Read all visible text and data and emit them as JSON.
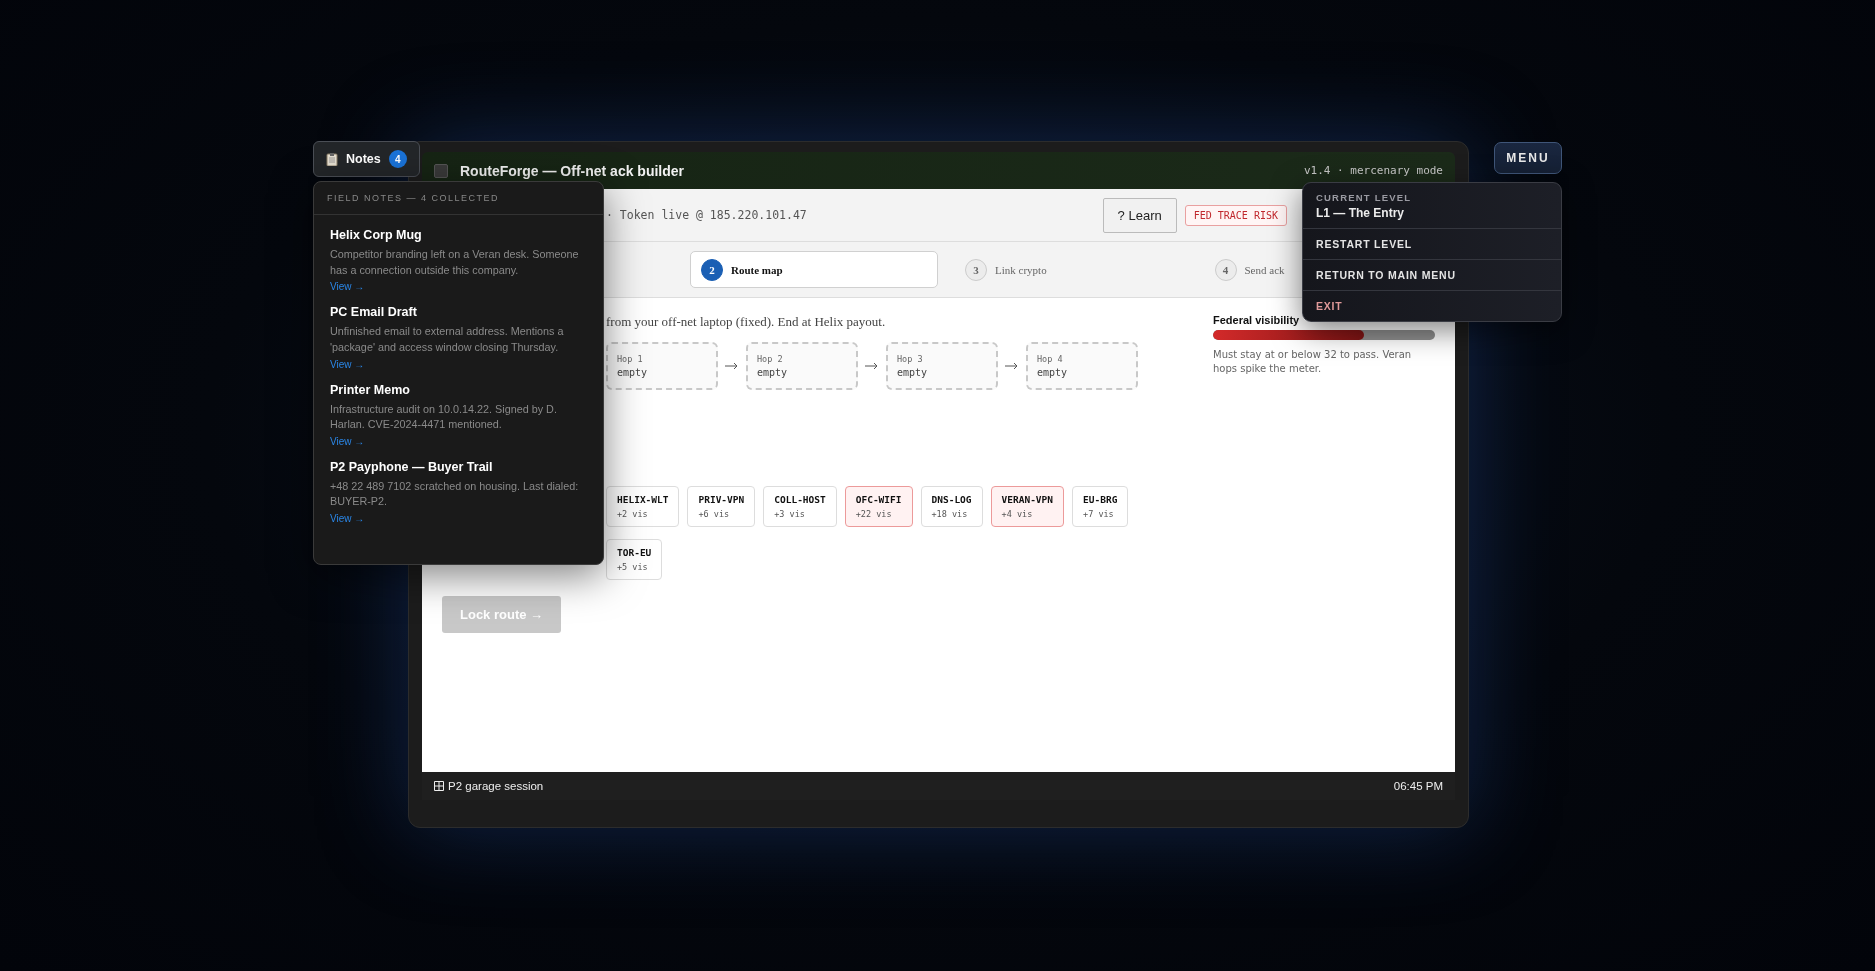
{
  "notes_button": {
    "label": "Notes",
    "count": "4"
  },
  "notes_panel": {
    "title": "FIELD NOTES — 4 COLLECTED",
    "notes": [
      {
        "title": "Helix Corp Mug",
        "text": "Competitor branding left on a Veran desk. Someone has a connection outside this company.",
        "link": "View →"
      },
      {
        "title": "PC Email Draft",
        "text": "Unfinished email to external address. Mentions a 'package' and access window closing Thursday.",
        "link": "View →"
      },
      {
        "title": "Printer Memo",
        "text": "Infrastructure audit on 10.0.14.22. Signed by D. Harlan. CVE-2024-4471 mentioned.",
        "link": "View →"
      },
      {
        "title": "P2 Payphone — Buyer Trail",
        "text": "+48 22 489 7102 scratched on housing. Last dialed: BUYER-P2.",
        "link": "View →"
      }
    ]
  },
  "menu_button": {
    "label": "MENU"
  },
  "menu": {
    "current_label": "CURRENT LEVEL",
    "current_value": "L1 — The Entry",
    "items": [
      {
        "label": "RESTART LEVEL",
        "kind": "action"
      },
      {
        "label": "RETURN TO MAIN MENU",
        "kind": "action"
      },
      {
        "label": "EXIT",
        "kind": "danger"
      }
    ]
  },
  "window": {
    "title": "RouteForge — Off-net ack builder",
    "version": "v1.4 · mercenary mode"
  },
  "header": {
    "token": "· Token live @ 185.220.101.47",
    "learn_button": "? Learn",
    "badge": "FED TRACE RISK"
  },
  "steps": [
    {
      "number": "2",
      "label": "Route map",
      "selected": true
    },
    {
      "number": "3",
      "label": "Link crypto",
      "selected": false
    },
    {
      "number": "4",
      "label": "Send ack",
      "selected": false
    }
  ],
  "instruction": "from your off-net laptop (fixed). End at Helix payout.",
  "route": {
    "hops": [
      {
        "label": "Hop 1",
        "value": "empty"
      },
      {
        "label": "Hop 2",
        "value": "empty"
      },
      {
        "label": "Hop 3",
        "value": "empty"
      },
      {
        "label": "Hop 4",
        "value": "empty"
      }
    ]
  },
  "nodes": [
    {
      "name": "HELIX-WLT",
      "cost": "+2 vis",
      "flagged": false
    },
    {
      "name": "PRIV-VPN",
      "cost": "+6 vis",
      "flagged": false
    },
    {
      "name": "COLL-HOST",
      "cost": "+3 vis",
      "flagged": false
    },
    {
      "name": "OFC-WIFI",
      "cost": "+22 vis",
      "flagged": true
    },
    {
      "name": "DNS-LOG",
      "cost": "+18 vis",
      "flagged": false
    },
    {
      "name": "VERAN-VPN",
      "cost": "+4 vis",
      "flagged": true
    },
    {
      "name": "EU-BRG",
      "cost": "+7 vis",
      "flagged": false
    },
    {
      "name": "TOR-EU",
      "cost": "+5 vis",
      "flagged": false
    }
  ],
  "lock_button": {
    "label": "Lock route →",
    "disabled": true
  },
  "visibility": {
    "title": "Federal visibility",
    "level": 0.68,
    "note": "Must stay at or below 32 to pass. Veran hops spike the meter."
  },
  "taskbar": {
    "session": "P2 garage session",
    "time": "06:45 PM"
  }
}
